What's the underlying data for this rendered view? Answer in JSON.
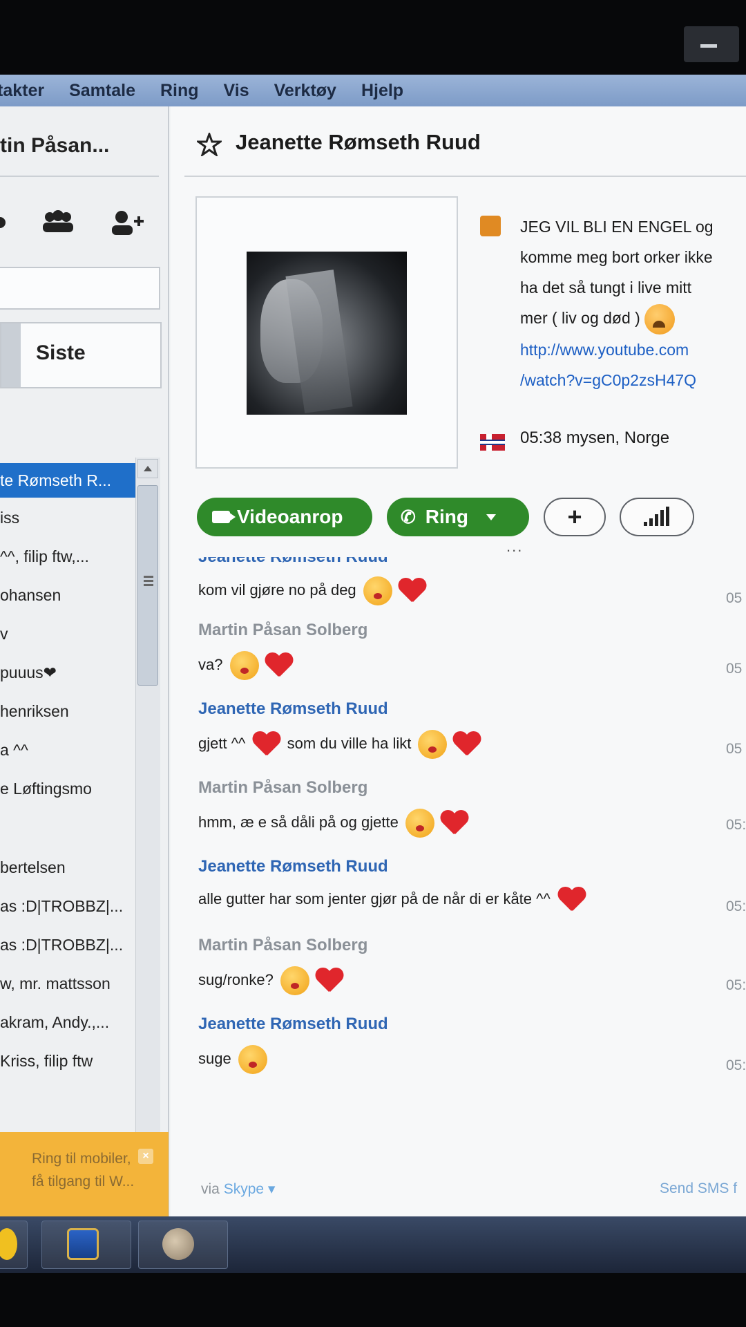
{
  "menu": [
    "takter",
    "Samtale",
    "Ring",
    "Vis",
    "Verktøy",
    "Hjelp"
  ],
  "sidebar": {
    "me_name": "tin Påsan...",
    "tab_label": "Siste",
    "contacts": [
      "te Rømseth R...",
      "iss",
      " ^^, filip ftw,...",
      "ohansen",
      "v",
      "puuus❤",
      "henriksen",
      "a ^^",
      "e Løftingsmo",
      "",
      " bertelsen",
      "as :D|TROBBZ|...",
      "as :D|TROBBZ|...",
      "w, mr. mattsson",
      "akram, Andy.,...",
      "Kriss, filip ftw"
    ],
    "promo_text": "Ring til mobiler, få tilgang til W..."
  },
  "profile": {
    "name": "Jeanette Rømseth Ruud",
    "mood_lines": [
      "JEG VIL BLI EN ENGEL og",
      "komme meg bort orker ikke",
      "ha det så tungt i live mitt",
      "mer ( liv og død )"
    ],
    "mood_link_1": "http://www.youtube.com",
    "mood_link_2": "/watch?v=gC0p2zsH47Q",
    "location": "05:38 mysen, Norge"
  },
  "actions": {
    "video": "Videoanrop",
    "ring": "Ring",
    "add": "+",
    "dots": "..."
  },
  "chat": {
    "top_sender": "Jeanette Rømseth Ruud",
    "messages": [
      {
        "sender": "",
        "text": "kom vil gjøre no på deg",
        "time": "05"
      },
      {
        "sender": "Martin Påsan Solberg",
        "text": "va?",
        "time": "05"
      },
      {
        "sender": "Jeanette Rømseth Ruud",
        "text": "gjett ^^",
        "text2": "som du ville ha likt",
        "time": "05"
      },
      {
        "sender": "Martin Påsan Solberg",
        "text": "hmm, æ e så dåli på og gjette",
        "time": "05:"
      },
      {
        "sender": "Jeanette Rømseth Ruud",
        "text": "alle gutter har som jenter gjør på de når di er kåte ^^",
        "time": "05:"
      },
      {
        "sender": "Martin Påsan Solberg",
        "text": "sug/ronke?",
        "time": "05:"
      },
      {
        "sender": "Jeanette Rømseth Ruud",
        "text": "suge",
        "time": "05:"
      }
    ],
    "via": "via",
    "via_service": "Skype",
    "send_sms": "Send SMS f"
  },
  "colors": {
    "accent_green": "#2f8a2a",
    "selected_blue": "#1f6fc9",
    "sender_blue": "#2f66b4",
    "promo_yellow": "#f3b43a"
  }
}
